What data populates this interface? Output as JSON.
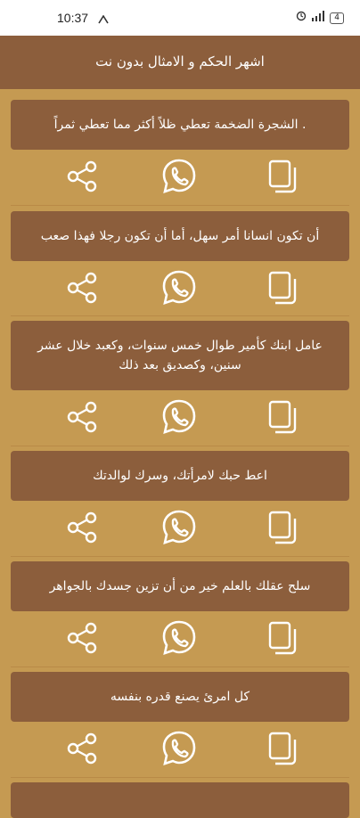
{
  "status": {
    "time": "10:37",
    "battery": "4"
  },
  "app": {
    "title": "اشهر الحكم و الامثال بدون نت"
  },
  "quotes": [
    {
      "text": "الشجرة الضخمة تعطي ظلاً أكثر مما تعطي ثمراً ."
    },
    {
      "text": "أن تكون انسانا أمر سهل، أما أن تكون رجلا فهذا صعب"
    },
    {
      "text": "عامل ابنك كأمير طوال خمس سنوات، وكعبد خلال عشر سنين، وكصديق بعد ذلك"
    },
    {
      "text": "اعط حبك لامرأتك، وسرك لوالدتك"
    },
    {
      "text": "سلح عقلك بالعلم خير من أن تزين جسدك بالجواهر"
    },
    {
      "text": "كل امرئ يصنع قدره بنفسه"
    }
  ],
  "icons": {
    "share": "share-icon",
    "whatsapp": "whatsapp-icon",
    "copy": "copy-icon"
  }
}
